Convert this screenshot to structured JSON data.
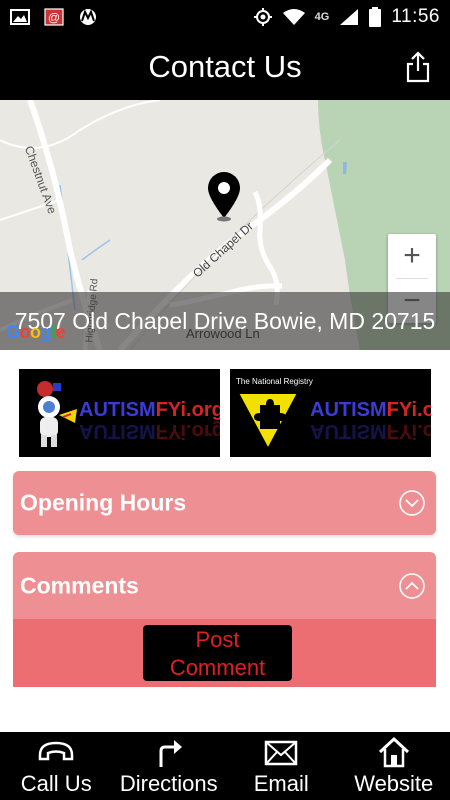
{
  "status_bar": {
    "time": "11:56",
    "network": "4G",
    "left_icons": [
      "image-icon",
      "mail-notification-icon",
      "motorola-icon"
    ],
    "right_icons": [
      "gps-icon",
      "wifi-icon",
      "signal-icon",
      "battery-icon"
    ]
  },
  "header": {
    "title": "Contact Us",
    "share_icon": "share-icon"
  },
  "map": {
    "address": "7507 Old Chapel Drive Bowie, MD 20715",
    "zoom_in": "+",
    "zoom_out": "−",
    "provider": "Google",
    "streets": {
      "chestnut": "Chestnut Ave",
      "old_chapel": "Old Chapel Dr",
      "highbridge": "Highbridge Rd",
      "arrowood": "Arrowood Ln"
    }
  },
  "logos": {
    "left": {
      "word1": "AUTISM",
      "word2": "FYi.org"
    },
    "right": {
      "caption": "The National Registry",
      "word1": "AUTISM",
      "word2": "FYi.org"
    }
  },
  "accordion": {
    "hours_title": "Opening Hours",
    "comments_title": "Comments",
    "post_line1": "Post",
    "post_line2": "Comment"
  },
  "bottom_nav": {
    "call": "Call Us",
    "directions": "Directions",
    "email": "Email",
    "website": "Website"
  },
  "colors": {
    "header_bg": "#000000",
    "panel": "#ee8f93",
    "panel_body": "#ec6e73",
    "post_text": "#e01f1f"
  }
}
